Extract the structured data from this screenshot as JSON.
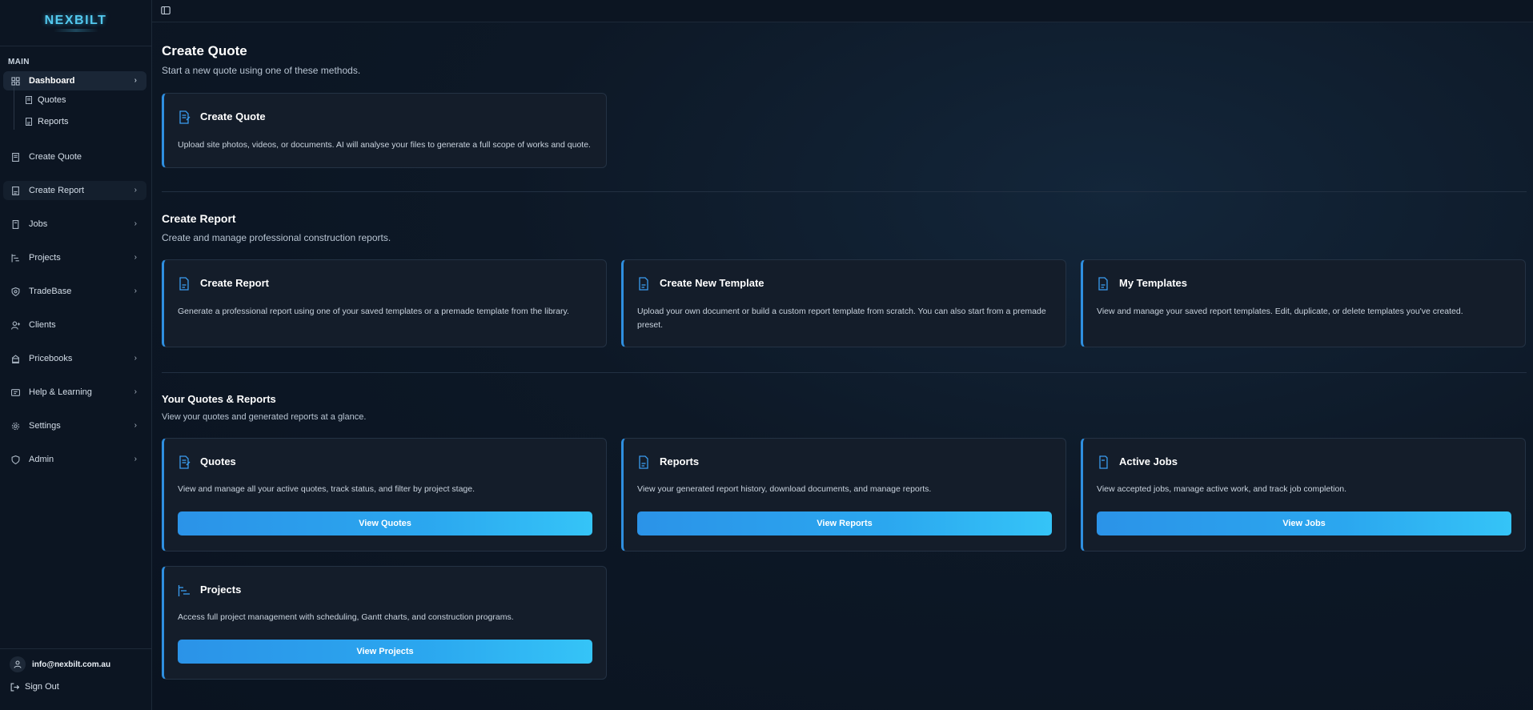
{
  "brand": {
    "logo": "NEXBILT"
  },
  "sidebar": {
    "section": "MAIN",
    "dashboard": "Dashboard",
    "sub": [
      "Quotes",
      "Reports"
    ],
    "items": [
      "Create Quote",
      "Create Report",
      "Jobs",
      "Projects",
      "TradeBase",
      "Clients",
      "Pricebooks",
      "Help & Learning",
      "Settings",
      "Admin"
    ],
    "user_email": "info@nexbilt.com.au",
    "sign_out": "Sign Out"
  },
  "quote_section": {
    "title": "Create Quote",
    "subtitle": "Start a new quote using one of these methods.",
    "card": {
      "title": "Create Quote",
      "text": "Upload site photos, videos, or documents. AI will analyse your files to generate a full scope of works and quote."
    }
  },
  "report_section": {
    "title": "Create Report",
    "subtitle": "Create and manage professional construction reports.",
    "cards": [
      {
        "title": "Create Report",
        "text": "Generate a professional report using one of your saved templates or a premade template from the library."
      },
      {
        "title": "Create New Template",
        "text": "Upload your own document or build a custom report template from scratch. You can also start from a premade preset."
      },
      {
        "title": "My Templates",
        "text": "View and manage your saved report templates. Edit, duplicate, or delete templates you've created."
      }
    ]
  },
  "overview_section": {
    "title": "Your Quotes & Reports",
    "subtitle": "View your quotes and generated reports at a glance.",
    "cards": [
      {
        "title": "Quotes",
        "text": "View and manage all your active quotes, track status, and filter by project stage.",
        "button": "View Quotes"
      },
      {
        "title": "Reports",
        "text": "View your generated report history, download documents, and manage reports.",
        "button": "View Reports"
      },
      {
        "title": "Active Jobs",
        "text": "View accepted jobs, manage active work, and track job completion.",
        "button": "View Jobs"
      },
      {
        "title": "Projects",
        "text": "Access full project management with scheduling, Gantt charts, and construction programs.",
        "button": "View Projects"
      }
    ]
  },
  "colors": {
    "accent": "#2f8fe0",
    "button_start": "#2b93e8",
    "button_end": "#35c4f7",
    "background": "#0b1420"
  },
  "icons": [
    "dashboard-icon",
    "quote-icon",
    "report-icon",
    "jobs-icon",
    "projects-icon",
    "tradebase-icon",
    "clients-icon",
    "pricebooks-icon",
    "help-icon",
    "settings-icon",
    "admin-icon",
    "user-icon",
    "sign-out-icon",
    "sidebar-toggle-icon"
  ]
}
